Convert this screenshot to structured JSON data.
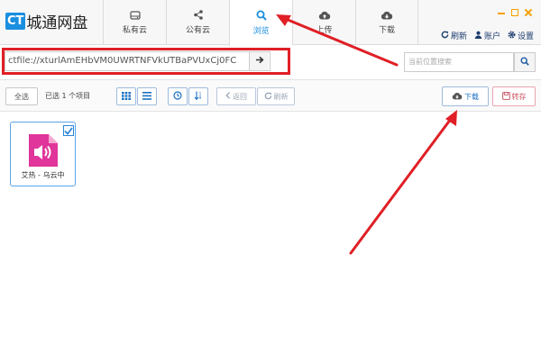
{
  "app": {
    "logo_badge": "CT",
    "logo_text": "城通网盘"
  },
  "tabs": [
    {
      "label": "私有云",
      "icon": "drive-icon",
      "active": false
    },
    {
      "label": "公有云",
      "icon": "share-icon",
      "active": false
    },
    {
      "label": "浏览",
      "icon": "search-icon",
      "active": true
    },
    {
      "label": "上传",
      "icon": "cloud-upload-icon",
      "active": false
    },
    {
      "label": "下载",
      "icon": "cloud-download-icon",
      "active": false
    }
  ],
  "account_bar": {
    "refresh": "刷新",
    "account": "账户",
    "settings": "设置"
  },
  "path": {
    "value": "ctfile://xturlAmEHbVM0UWRTNFVkUTBaPVUxCj0FC",
    "search_placeholder": "当前位置搜索"
  },
  "toolbar": {
    "select_all": "全选",
    "selected_count": "已选 1 个项目",
    "back": "返回",
    "refresh": "刷新",
    "download": "下载",
    "save": "转存"
  },
  "files": [
    {
      "name": "艾热 - 乌云中",
      "type": "audio",
      "selected": true
    }
  ],
  "colors": {
    "accent": "#1a8fe0",
    "annotation": "#e01f26",
    "window_controls": "#f5a000",
    "file_icon": "#e0359a"
  }
}
